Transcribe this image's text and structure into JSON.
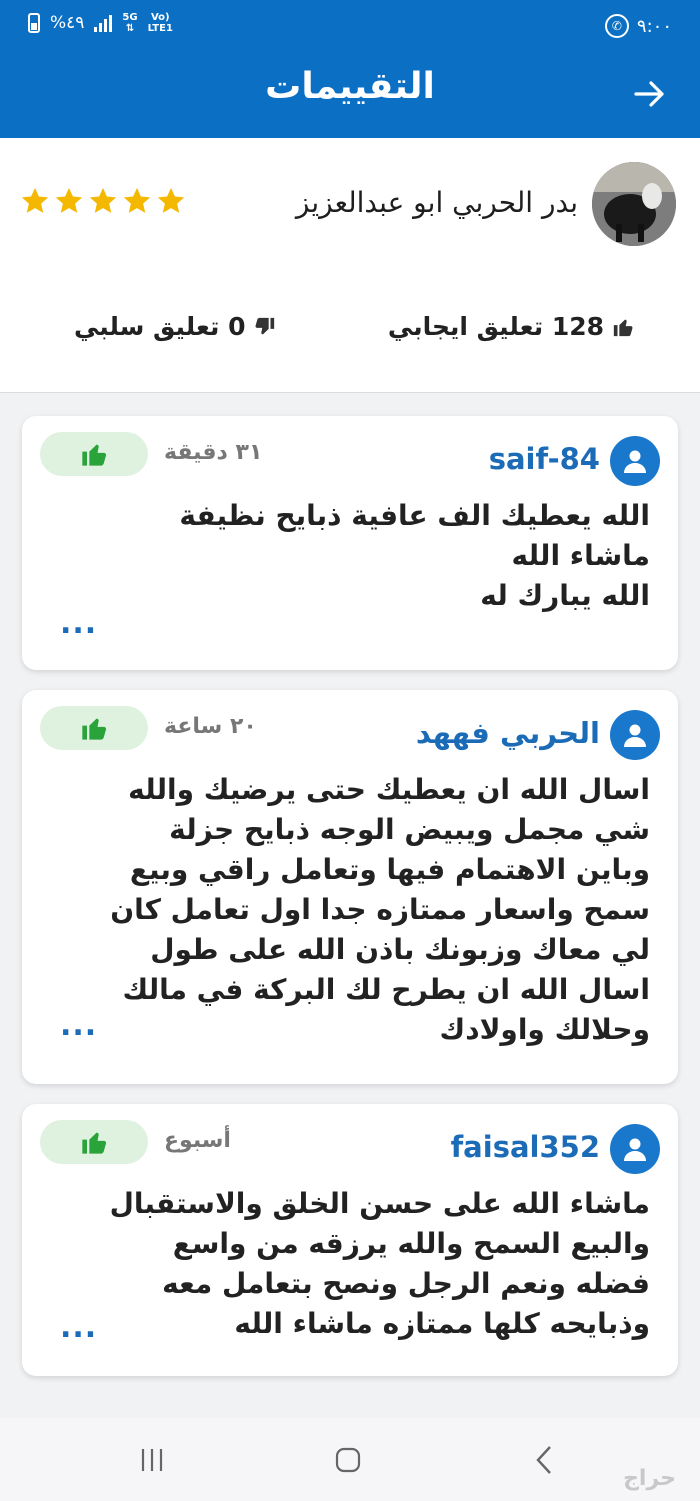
{
  "status_bar": {
    "time": "٩:٠٠",
    "battery": "%٤٩",
    "network_top": "5G",
    "network_volte": "Vo)",
    "network_lte": "LTE1"
  },
  "app_bar": {
    "title": "التقييمات"
  },
  "seller": {
    "name": "بدر الحربي ابو عبدالعزيز",
    "rating": 5,
    "star_color": "#f5b800"
  },
  "stats": {
    "positive_label": "128 تعليق ايجابي",
    "negative_label": "0 تعليق سلبي"
  },
  "reviews": [
    {
      "username": "saif-84",
      "time": "٣١ دقيقة",
      "text": "الله يعطيك الف عافية  ذبايح نظيفة\nماشاء الله\nالله يبارك له",
      "more": "..."
    },
    {
      "username": "الحربي فههد",
      "time": "٢٠ ساعة",
      "text": "اسال الله ان يعطيك حتى يرضيك والله\nشي مجمل ويبيض الوجه ذبايح جزلة\nوباين الاهتمام فيها وتعامل راقي وبيع\nسمح واسعار ممتازه جدا  اول تعامل كان\nلي معاك وزبونك باذن الله على طول\nاسال الله ان يطرح لك البركة في مالك\nوحلالك واولادك",
      "more": "..."
    },
    {
      "username": "faisal352",
      "time": "أسبوع",
      "text": "ماشاء الله على حسن الخلق والاستقبال\nوالبيع السمح والله يرزقه من واسع\nفضله ونعم الرجل ونصح بتعامل معه\nوذبايحه كلها ممتازه ماشاء الله",
      "more": "..."
    }
  ],
  "colors": {
    "brand_blue": "#0b70c4",
    "link_blue": "#1b6bb7",
    "like_green": "#2aa33a",
    "like_bg": "#dff2e0"
  },
  "watermark": "حراج"
}
